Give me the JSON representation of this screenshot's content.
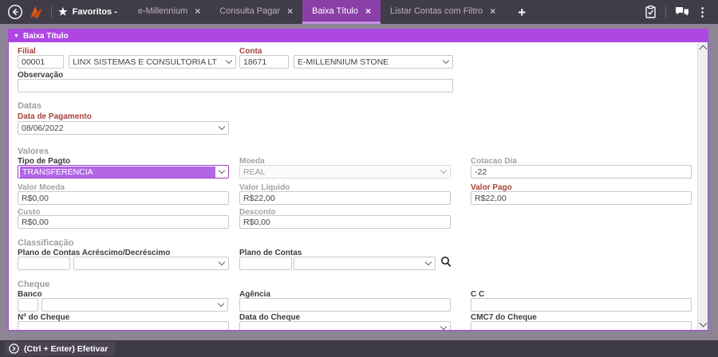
{
  "icons": {
    "star": "★",
    "close": "×",
    "plus": "+",
    "kebab": "⋮",
    "caret": "▼"
  },
  "topbar": {
    "favorites_label": "Favoritos -",
    "tabs": [
      {
        "label": "e-Millennium"
      },
      {
        "label": "Consulta Pagar"
      },
      {
        "label": "Baixa Título"
      },
      {
        "label": "Listar Contas com Filtro"
      }
    ]
  },
  "panel": {
    "title": "Baixa Título"
  },
  "form": {
    "filial": {
      "label": "Filial",
      "code": "00001",
      "name": "LINX SISTEMAS E CONSULTORIA LT"
    },
    "conta": {
      "label": "Conta",
      "code": "18671",
      "name": "E-MILLENNIUM STONE"
    },
    "observacao": {
      "label": "Observação",
      "value": ""
    },
    "datas": {
      "section": "Datas",
      "data_pagamento": {
        "label": "Data de Pagamento",
        "value": "08/06/2022"
      }
    },
    "valores": {
      "section": "Valores",
      "tipo_pagto": {
        "label": "Tipo de Pagto",
        "value": "TRANSFERENCIA"
      },
      "moeda": {
        "label": "Moeda",
        "value": "REAL"
      },
      "cotacao_dia": {
        "label": "Cotacao Dia",
        "value": "-22"
      },
      "valor_moeda": {
        "label": "Valor Moeda",
        "value": "R$0,00"
      },
      "valor_liquido": {
        "label": "Valor Líquido",
        "value": "R$22,00"
      },
      "valor_pago": {
        "label": "Valor Pago",
        "value": "R$22,00"
      },
      "custo": {
        "label": "Custo",
        "value": "R$0,00"
      },
      "desconto": {
        "label": "Desconto",
        "value": "R$0,00"
      }
    },
    "classificacao": {
      "section": "Classificação",
      "plano_acrescimo": {
        "label": "Plano de Contas Acréscimo/Decréscimo",
        "code": "",
        "name": ""
      },
      "plano_contas": {
        "label": "Plano de Contas",
        "code": "",
        "name": ""
      }
    },
    "cheque": {
      "section": "Cheque",
      "banco": {
        "label": "Banco",
        "code": "",
        "name": ""
      },
      "agencia": {
        "label": "Agência",
        "value": ""
      },
      "cc": {
        "label": "C C",
        "value": ""
      },
      "numero": {
        "label": "Nº do Cheque",
        "value": ""
      },
      "data": {
        "label": "Data do Cheque",
        "value": ""
      },
      "cmc7": {
        "label": "CMC7 do Cheque",
        "value": ""
      }
    }
  },
  "footer": {
    "efetivar_label": "(Ctrl + Enter) Efetivar"
  },
  "colors": {
    "accent_purple": "#ad46e3",
    "topbar": "#413c49",
    "active_tab": "#8a3fa8",
    "brand_orange": "#e55c12",
    "label_red": "#a8423a"
  }
}
